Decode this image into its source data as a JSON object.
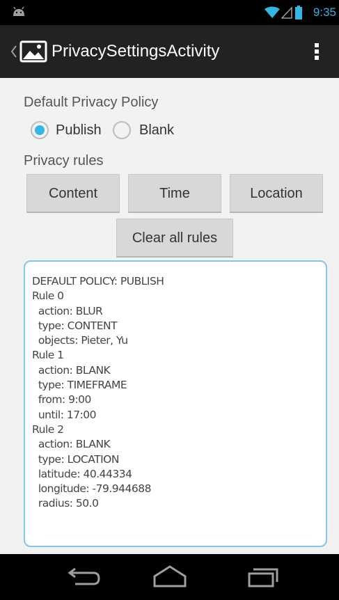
{
  "status_bar": {
    "time": "9:35",
    "icons": [
      "android-notification-icon",
      "wifi-icon",
      "signal-icon",
      "battery-icon"
    ],
    "accent_color": "#33b5e5"
  },
  "action_bar": {
    "title": "PrivacySettingsActivity",
    "icons": [
      "up-caret-icon",
      "app-image-icon",
      "overflow-menu-icon"
    ]
  },
  "default_policy": {
    "heading": "Default Privacy Policy",
    "options": [
      {
        "label": "Publish",
        "selected": true
      },
      {
        "label": "Blank",
        "selected": false
      }
    ]
  },
  "privacy_rules": {
    "heading": "Privacy rules",
    "buttons": [
      "Content",
      "Time",
      "Location"
    ],
    "clear_button": "Clear all rules"
  },
  "rules_text": [
    "DEFAULT POLICY: PUBLISH",
    "Rule 0",
    "  action: BLUR",
    "  type: CONTENT",
    "  objects: Pieter, Yu",
    "Rule 1",
    "  action: BLANK",
    "  type: TIMEFRAME",
    "  from: 9:00",
    "  until: 17:00",
    "Rule 2",
    "  action: BLANK",
    "  type: LOCATION",
    "  latitude: 40.44334",
    "  longitude: -79.944688",
    "  radius: 50.0"
  ],
  "nav_bar": {
    "buttons": [
      "back-icon",
      "home-icon",
      "recent-apps-icon"
    ]
  }
}
